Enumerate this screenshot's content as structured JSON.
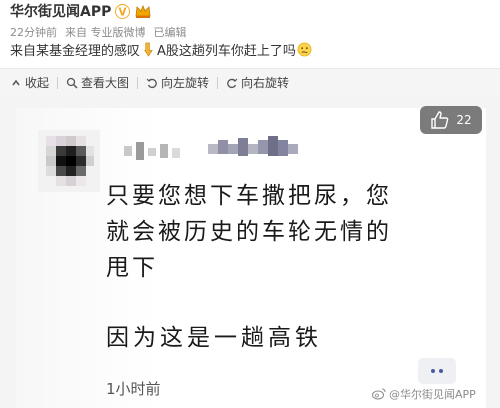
{
  "post": {
    "username": "华尔街见闻APP",
    "meta": {
      "time": "22分钟前",
      "source_prefix": "来自",
      "source": "某基金经理的感叹",
      "client": "专业版微博",
      "edited": "已编辑"
    },
    "text_part1": "来自某基金经理的感叹",
    "text_part2": "A股这趟列车你赶上了吗"
  },
  "toolbar": {
    "collapse": "收起",
    "view_large": "查看大图",
    "rotate_left": "向左旋转",
    "rotate_right": "向右旋转"
  },
  "image": {
    "line1": "只要您想下车撒把尿，您",
    "line2": "就会被历史的车轮无情的",
    "line3": "甩下",
    "line4": "因为这是一趟高铁",
    "time": "1小时前",
    "like_count": "22",
    "watermark": "@华尔街见闻APP"
  },
  "colors": {
    "accent": "#e8891a",
    "badge_bg": "#7b7b7b",
    "toolbar_bg": "#f5f5f5"
  }
}
